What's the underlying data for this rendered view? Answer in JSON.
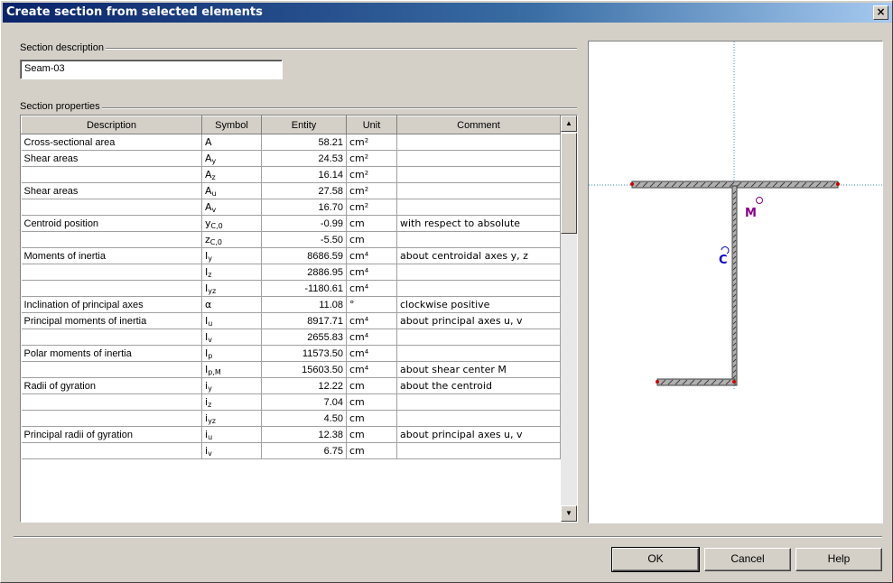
{
  "dialog": {
    "title": "Create section from selected elements",
    "close_label": "×"
  },
  "section_description": {
    "label": "Section description",
    "value": "Seam-03"
  },
  "section_properties": {
    "label": "Section properties",
    "columns": [
      "Description",
      "Symbol",
      "Entity",
      "Unit",
      "Comment"
    ],
    "rows": [
      {
        "description": "Cross-sectional area",
        "symbol": "A",
        "sub": "",
        "entity": "58.21",
        "unit": "cm²",
        "comment": ""
      },
      {
        "description": "Shear areas",
        "symbol": "A",
        "sub": "y",
        "entity": "24.53",
        "unit": "cm²",
        "comment": ""
      },
      {
        "description": "",
        "symbol": "A",
        "sub": "z",
        "entity": "16.14",
        "unit": "cm²",
        "comment": ""
      },
      {
        "description": "Shear areas",
        "symbol": "A",
        "sub": "u",
        "entity": "27.58",
        "unit": "cm²",
        "comment": ""
      },
      {
        "description": "",
        "symbol": "A",
        "sub": "v",
        "entity": "16.70",
        "unit": "cm²",
        "comment": ""
      },
      {
        "description": "Centroid position",
        "symbol": "y",
        "sub": "C,0",
        "entity": "-0.99",
        "unit": "cm",
        "comment": "with respect to absolute"
      },
      {
        "description": "",
        "symbol": "z",
        "sub": "C,0",
        "entity": "-5.50",
        "unit": "cm",
        "comment": ""
      },
      {
        "description": "Moments of inertia",
        "symbol": "I",
        "sub": "y",
        "entity": "8686.59",
        "unit": "cm⁴",
        "comment": "about centroidal axes y, z"
      },
      {
        "description": "",
        "symbol": "I",
        "sub": "z",
        "entity": "2886.95",
        "unit": "cm⁴",
        "comment": ""
      },
      {
        "description": "",
        "symbol": "I",
        "sub": "yz",
        "entity": "-1180.61",
        "unit": "cm⁴",
        "comment": ""
      },
      {
        "description": "Inclination of principal axes",
        "symbol": "α",
        "sub": "",
        "entity": "11.08",
        "unit": "°",
        "comment": "clockwise positive"
      },
      {
        "description": "Principal moments of inertia",
        "symbol": "I",
        "sub": "u",
        "entity": "8917.71",
        "unit": "cm⁴",
        "comment": "about principal axes u, v"
      },
      {
        "description": "",
        "symbol": "I",
        "sub": "v",
        "entity": "2655.83",
        "unit": "cm⁴",
        "comment": ""
      },
      {
        "description": "Polar moments of inertia",
        "symbol": "I",
        "sub": "p",
        "entity": "11573.50",
        "unit": "cm⁴",
        "comment": ""
      },
      {
        "description": "",
        "symbol": "I",
        "sub": "p,M",
        "entity": "15603.50",
        "unit": "cm⁴",
        "comment": "about shear center M"
      },
      {
        "description": "Radii of gyration",
        "symbol": "i",
        "sub": "y",
        "entity": "12.22",
        "unit": "cm",
        "comment": "about the centroid"
      },
      {
        "description": "",
        "symbol": "i",
        "sub": "z",
        "entity": "7.04",
        "unit": "cm",
        "comment": ""
      },
      {
        "description": "",
        "symbol": "i",
        "sub": "yz",
        "entity": "4.50",
        "unit": "cm",
        "comment": ""
      },
      {
        "description": "Principal radii of gyration",
        "symbol": "i",
        "sub": "u",
        "entity": "12.38",
        "unit": "cm",
        "comment": "about principal axes u, v"
      },
      {
        "description": "",
        "symbol": "i",
        "sub": "v",
        "entity": "6.75",
        "unit": "cm",
        "comment": ""
      }
    ]
  },
  "preview": {
    "centroid_label": "C",
    "shear_center_label": "M",
    "colors": {
      "section": "#555555",
      "axis": "#3a8fb0",
      "centroid": "#0000cc",
      "shear_center": "#880088",
      "node": "#cc0000"
    }
  },
  "buttons": {
    "ok": "OK",
    "cancel": "Cancel",
    "help": "Help"
  }
}
